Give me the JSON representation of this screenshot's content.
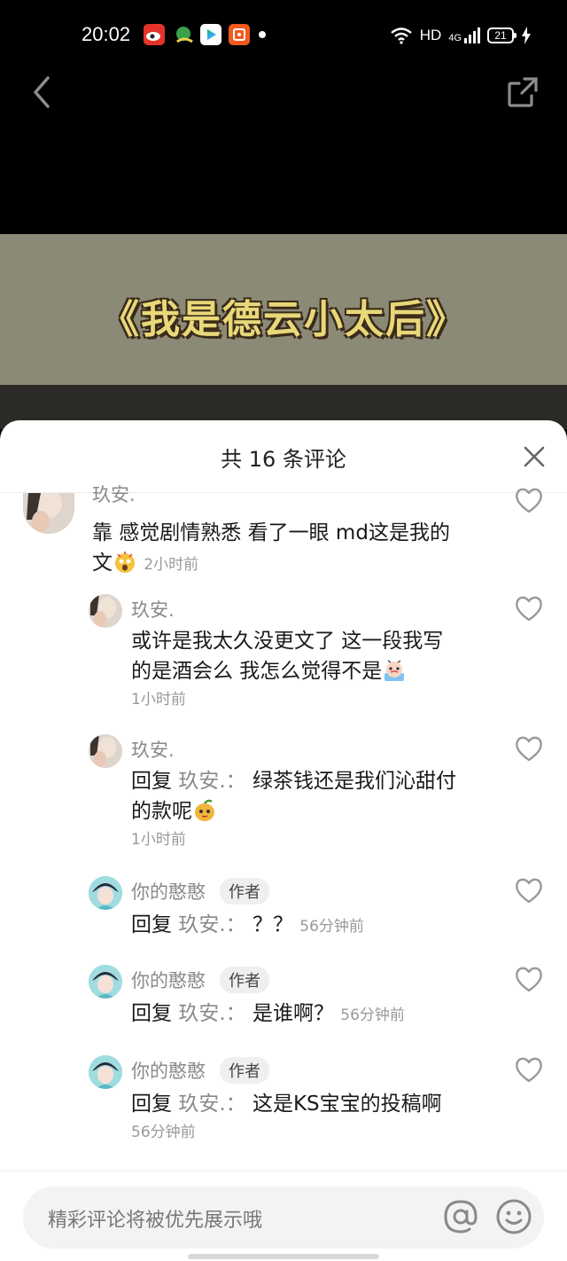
{
  "status_bar": {
    "time": "20:02",
    "network": "HD",
    "signal_label": "4G",
    "battery": "21",
    "app_icons": [
      {
        "name": "weibo-icon",
        "color": "#e6332a"
      },
      {
        "name": "app-icon-green",
        "color": "#3aa14a"
      },
      {
        "name": "video-app-icon",
        "color": "#2ea8f0"
      },
      {
        "name": "shop-app-icon",
        "color": "#f25a1e"
      }
    ]
  },
  "video": {
    "overlay_title": "《我是德云小太后》"
  },
  "comments_sheet": {
    "title": "共 16 条评论",
    "comments": [
      {
        "name": "玖安.",
        "text_line1": "靠 感觉剧情熟悉 看了一眼 md这是我的",
        "text_line2": "文",
        "emoji": "shocked-emoji",
        "time": "2小时前"
      },
      {
        "name": "玖安.",
        "text_line1": "或许是我太久没更文了 这一段我写",
        "text_line2": "的是酒会么 我怎么觉得不是",
        "emoji": "crying-emoji",
        "time": "1小时前"
      },
      {
        "name": "玖安.",
        "reply_label": "回复",
        "reply_to": "玖安.：",
        "text_line1": "绿茶钱还是我们沁甜付",
        "text_line2": "的款呢",
        "emoji": "mango-emoji",
        "time": "1小时前"
      },
      {
        "name": "你的憨憨",
        "tag": "作者",
        "reply_label": "回复",
        "reply_to": "玖安.：",
        "text": "？？",
        "time": "56分钟前"
      },
      {
        "name": "你的憨憨",
        "tag": "作者",
        "reply_label": "回复",
        "reply_to": "玖安.：",
        "text": "是谁啊？",
        "time": "56分钟前"
      },
      {
        "name": "你的憨憨",
        "tag": "作者",
        "reply_label": "回复",
        "reply_to": "玖安.：",
        "text": "这是KS宝宝的投稿啊",
        "time": "56分钟前"
      }
    ]
  },
  "input": {
    "placeholder": "精彩评论将被优先展示哦"
  }
}
